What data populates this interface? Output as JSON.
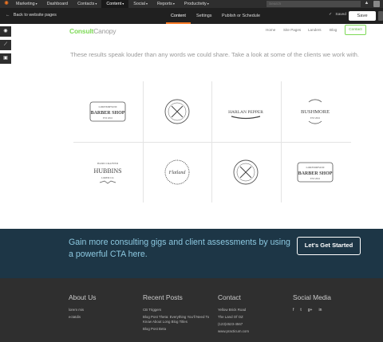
{
  "topnav": {
    "items": [
      {
        "label": "Marketing",
        "caret": true
      },
      {
        "label": "Dashboard",
        "caret": false
      },
      {
        "label": "Contacts",
        "caret": true
      },
      {
        "label": "Content",
        "caret": true
      },
      {
        "label": "Social",
        "caret": true
      },
      {
        "label": "Reports",
        "caret": true
      },
      {
        "label": "Productivity",
        "caret": true
      }
    ],
    "search_placeholder": "Search",
    "accent_color": "#f57722"
  },
  "toolbar": {
    "back_label": "Back to website pages",
    "tabs": [
      {
        "label": "Content",
        "active": true
      },
      {
        "label": "Settings",
        "active": false
      },
      {
        "label": "Publish or Schedule",
        "active": false
      }
    ],
    "saved_label": "Saved",
    "save_label": "Save"
  },
  "rail": {
    "icons": [
      "eye-icon",
      "chart-icon",
      "cube-icon"
    ]
  },
  "site": {
    "brand_part1": "Consult",
    "brand_part2": "Canopy",
    "nav": [
      "Home",
      "Site Pages",
      "Landers",
      "Blog"
    ],
    "contact_label": "Contact",
    "brand_color": "#7ed957"
  },
  "tagline": "These results speak louder than any words we could share. Take a look at some of the clients we work with.",
  "clients": [
    {
      "name": "BARBER SHOP",
      "top": "LOREMIPSUM",
      "bottom": "EST 2016"
    },
    {
      "name": "",
      "top": "",
      "bottom": ""
    },
    {
      "name": "HARLAN PEPPER",
      "top": "",
      "bottom": ""
    },
    {
      "name": "BUSHMORE",
      "top": "",
      "bottom": "EST 2016"
    },
    {
      "name": "HUBBINS",
      "top": "HAND CRAFTED",
      "bottom": "LOREM CO."
    },
    {
      "name": "Flatland",
      "top": "",
      "bottom": ""
    },
    {
      "name": "",
      "top": "",
      "bottom": ""
    },
    {
      "name": "BARBER SHOP",
      "top": "LOREMIPSUM",
      "bottom": "EST 2016"
    }
  ],
  "cta": {
    "text": "Gain more consulting gigs and client assessments by using a powerful CTA here.",
    "button_label": "Let's Get Started",
    "bg_color": "#1d3646"
  },
  "footer": {
    "about": {
      "title": "About Us",
      "lines": [
        "lorem mis",
        "ectatdis"
      ]
    },
    "posts": {
      "title": "Recent Posts",
      "items": [
        "CB Triggers",
        "Blog Post Theta: Everything You'll Need To Know About Long Blog Titles",
        "Blog Post Beta"
      ]
    },
    "contact": {
      "title": "Contact",
      "lines": [
        "Yellow Brick Road",
        "The Land Of OZ",
        "(123)4523-4567",
        "www.practicum.com"
      ]
    },
    "social": {
      "title": "Social Media",
      "icons": [
        "f",
        "t",
        "g+",
        "in"
      ]
    }
  }
}
